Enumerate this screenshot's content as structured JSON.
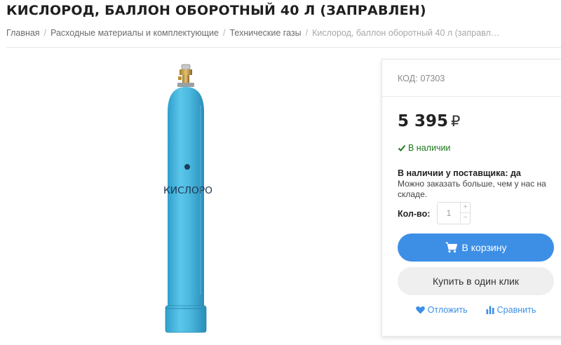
{
  "page": {
    "title": "КИСЛОРОД, БАЛЛОН ОБОРОТНЫЙ 40 Л (ЗАПРАВЛЕН)"
  },
  "breadcrumb": {
    "items": [
      "Главная",
      "Расходные материалы и комплектующие",
      "Технические газы"
    ],
    "current": "Кислород, баллон оборотный 40 л (заправл…"
  },
  "product": {
    "image_icon": "oxygen-cylinder",
    "image_label": "КИСЛОРО",
    "image_color": "#4bb8de"
  },
  "buy_box": {
    "sku_label": "КОД:",
    "sku_value": "07303",
    "price": "5 395",
    "currency": "₽",
    "stock_status": "В наличии",
    "supplier_title": "В наличии у поставщика: да",
    "supplier_note": "Можно заказать больше, чем у нас на складе.",
    "qty_label": "Кол-во:",
    "qty_value": "1",
    "qty_up": "+",
    "qty_down": "−",
    "add_to_cart": "В корзину",
    "buy_one_click": "Купить в один клик",
    "wishlist": "Отложить",
    "compare": "Сравнить",
    "accent_color": "#3d8fe6",
    "stock_color": "#1a7a1a"
  }
}
